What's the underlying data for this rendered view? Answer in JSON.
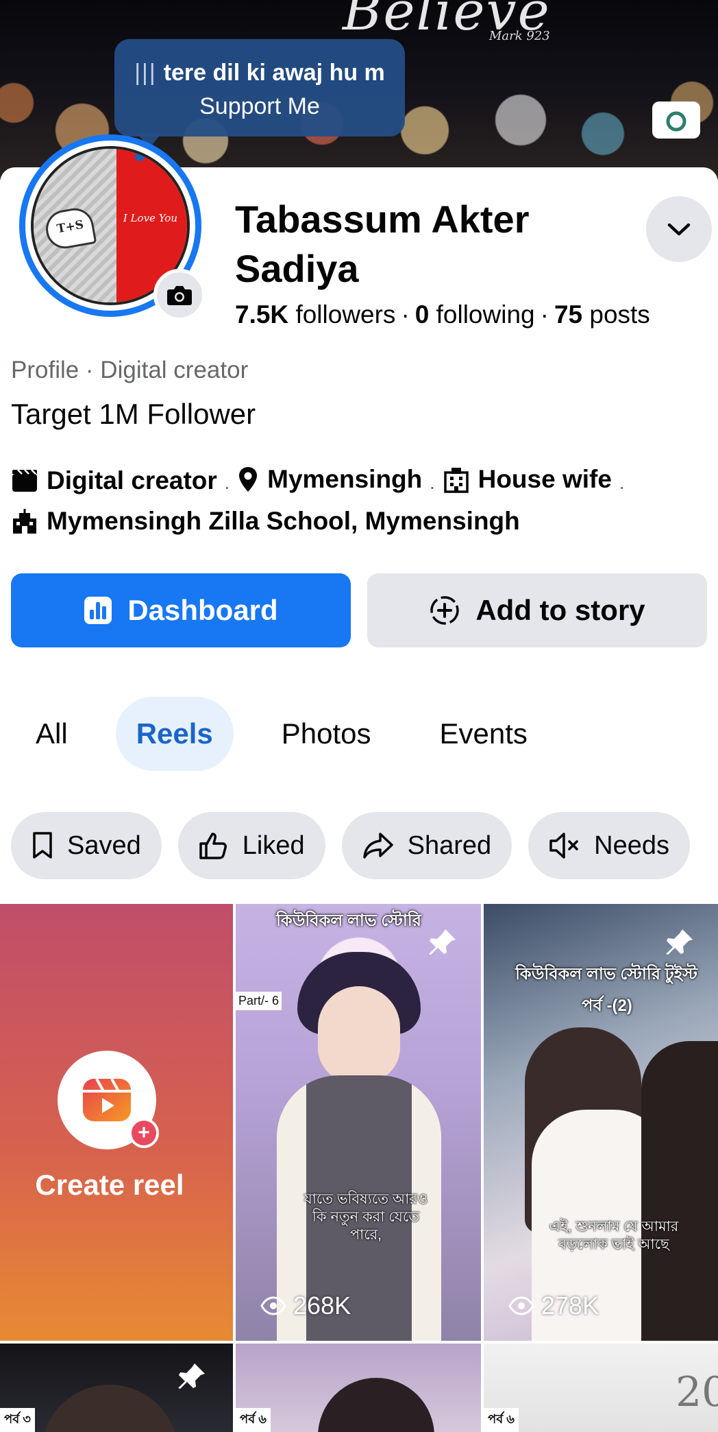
{
  "cover": {
    "script_text": "Believe",
    "mark_text": "Mark 923"
  },
  "tooltip": {
    "bars": "|||",
    "line1": "tere dil ki awaj hu m",
    "line2": "Support Me"
  },
  "profile": {
    "name": "Tabassum Akter Sadiya",
    "followers_count": "7.5K",
    "followers_label": "followers",
    "following_count": "0",
    "following_label": "following",
    "posts_count": "75",
    "posts_label": "posts",
    "category": "Profile · Digital creator",
    "bio": "Target 1M Follower",
    "avatar_tag": "T+S",
    "avatar_script": "I Love You"
  },
  "details": [
    {
      "icon": "clapperboard-icon",
      "text": "Digital creator"
    },
    {
      "icon": "location-pin-icon",
      "text": "Mymensingh"
    },
    {
      "icon": "building-icon",
      "text": "House wife"
    },
    {
      "icon": "school-icon",
      "text": "Mymensingh Zilla School, Mymensingh"
    }
  ],
  "buttons": {
    "dashboard": "Dashboard",
    "add_story": "Add to story"
  },
  "tabs": [
    {
      "label": "All",
      "active": false
    },
    {
      "label": "Reels",
      "active": true
    },
    {
      "label": "Photos",
      "active": false
    },
    {
      "label": "Events",
      "active": false
    }
  ],
  "chips": [
    {
      "icon": "bookmark-icon",
      "label": "Saved"
    },
    {
      "icon": "thumbs-up-icon",
      "label": "Liked"
    },
    {
      "icon": "share-icon",
      "label": "Shared"
    },
    {
      "icon": "muted-speaker-icon",
      "label": "Needs"
    }
  ],
  "grid": {
    "create_label": "Create reel",
    "reels": [
      {
        "top_text": "কিউবিকল লাভ স্টোরি",
        "part_tag": "Part/- 6",
        "caption": "যাতে ভবিষ্যতে আরও কি নতুন করা যেতে পারে,",
        "views": "268K",
        "pinned": true
      },
      {
        "top_text": "কিউবিকল লাভ স্টোরি টুইস্ট",
        "top_text_2": "পর্ব -(2)",
        "caption": "এই, শুনলাম যে আমার বড়লোক ভাই আছে",
        "views": "278K",
        "pinned": true
      }
    ],
    "bottom_tags": [
      "পর্ব ৩",
      "পর্ব ৬",
      "পর্ব ৬"
    ],
    "bottom_right_text": "20"
  },
  "colors": {
    "brand_blue": "#1877f2",
    "chip_bg": "#e4e6eb",
    "tab_active_bg": "#e7f1fd",
    "tab_active_text": "#1b65c9"
  }
}
